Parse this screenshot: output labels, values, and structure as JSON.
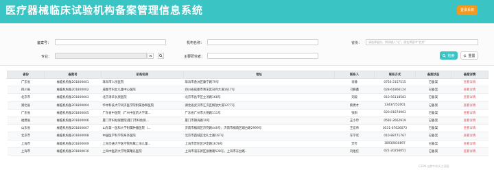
{
  "header": {
    "title": "医疗器械临床试验机构备案管理信息系统",
    "login_label": "登录系统"
  },
  "search": {
    "record_no_label": "备案号：",
    "org_name_label": "机构名称：",
    "province_label": "省份：",
    "province_placeholder": "请选择省份，例如输入“sj”，即在界面中“北京”",
    "specialty_label": "专业：",
    "investigator_label": "主要研究者：",
    "search_button": "检索",
    "reset_button": "重置"
  },
  "table": {
    "columns": [
      "省份",
      "备案号",
      "机构名称",
      "地址",
      "联系人",
      "联系方式",
      "备案状态",
      "备案详情"
    ],
    "detail_label": "查看详情",
    "rows": [
      [
        "广东省",
        "械临机构备201800001",
        "珠海市人民医院",
        "珠海市香洲区康宁路79号",
        "肖静",
        "0756-2157515",
        "已备案"
      ],
      [
        "四川省",
        "械临机构备201800002",
        "成都市妇女儿童中心医院",
        "四川省成都市青羊区日月大道1617号",
        "刁鹏鑫",
        "028-61866124",
        "已备案"
      ],
      [
        "北京市",
        "械临机构备201800003",
        "北京清华长庚医院",
        "北京市昌平区立汤路168号",
        "刘毅",
        "010-56118583",
        "已备案"
      ],
      [
        "湖北省",
        "械临机构备201800004",
        "华中科技大学同济医学院附属协和医院",
        "湖北省武汉市江汉区解放大道1277号",
        "蔡建才",
        "13437252001",
        "已备案"
      ],
      [
        "广东省",
        "械临机构备201800005",
        "广东省中医院（广州中医药大学第...",
        "广东省广州市大德路111号",
        "张阳",
        "020-81874903",
        "已备案"
      ],
      [
        "福建省",
        "械临机构备201800006",
        "厦门市妇幼保健院(厦门市妇幼保...",
        "厦门市镇海路10号",
        "王小玲",
        "0592-2662919",
        "已备案"
      ],
      [
        "山东省",
        "械临机构备201800007",
        "山东第一医科大学附属肿瘤医院（...",
        "济南市槐荫区济兖路440号；济南市槐荫区烟台路2999号",
        "王宏伟",
        "0531-67626073",
        "已备案"
      ],
      [
        "北京市",
        "械临机构备201800008",
        "中国医学科学院阜外医院",
        "北京市西城区北礼士路167号",
        "车学欢",
        "010-88771767",
        "已备案"
      ],
      [
        "上海市",
        "械临机构备201800009",
        "上海交通大学医学院附属上海儿童...",
        "上海市普陀区泸定路1678号",
        "李芳",
        "18930830897",
        "已备案"
      ],
      [
        "上海市",
        "械临机构备201800010",
        "上海中医药大学附属曙光医院",
        "上海市浦东新区张衡路528号，上海市东台路..",
        "刘维佗",
        "021-20256051",
        "已备案"
      ]
    ]
  },
  "watermark": "CSDN @梦中的天之酒壶",
  "colors": {
    "header_bg": "#3bc4c4",
    "login_bg": "#f39a1e",
    "detail_link": "#e8505b",
    "search_button_bg": "#3bc4c4"
  },
  "icons": {
    "clear": "close-icon",
    "lookup": "search-icon",
    "search_button": "search-icon",
    "reset_button": "refresh-icon"
  }
}
